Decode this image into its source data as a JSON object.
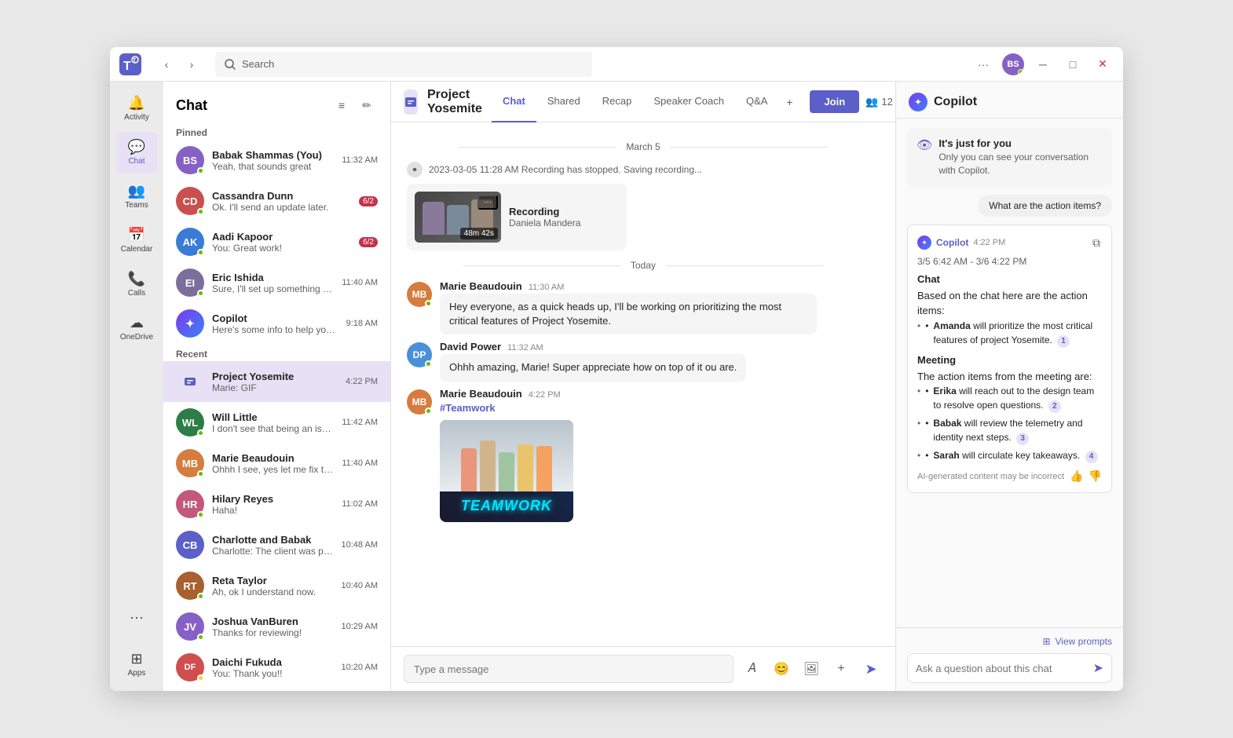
{
  "window": {
    "title": "Microsoft Teams"
  },
  "titlebar": {
    "search_placeholder": "Search",
    "more_label": "···",
    "minimize_label": "─",
    "maximize_label": "□",
    "close_label": "✕"
  },
  "sidebar": {
    "items": [
      {
        "id": "activity",
        "label": "Activity",
        "icon": "🔔",
        "badge": null,
        "active": false
      },
      {
        "id": "chat",
        "label": "Chat",
        "icon": "💬",
        "badge": null,
        "active": true
      },
      {
        "id": "teams",
        "label": "Teams",
        "icon": "👥",
        "badge": null,
        "active": false
      },
      {
        "id": "calendar",
        "label": "Calendar",
        "icon": "📅",
        "badge": null,
        "active": false
      },
      {
        "id": "calls",
        "label": "Calls",
        "icon": "📞",
        "badge": null,
        "active": false
      },
      {
        "id": "onedrive",
        "label": "OneDrive",
        "icon": "☁",
        "badge": null,
        "active": false
      }
    ],
    "more_label": "···",
    "apps_label": "Apps"
  },
  "chat_list": {
    "title": "Chat",
    "pinned_label": "Pinned",
    "recent_label": "Recent",
    "pinned": [
      {
        "name": "Babak Shammas (You)",
        "preview": "Yeah, that sounds great",
        "time": "11:32 AM",
        "badge": null,
        "avatar_color": "#8661c5",
        "avatar_initials": "BS",
        "status": "online"
      },
      {
        "name": "Cassandra Dunn",
        "preview": "Ok. I'll send an update later.",
        "time": "6/2",
        "badge": "6/2",
        "avatar_color": "#ca4f4f",
        "avatar_initials": "CD",
        "status": "online"
      },
      {
        "name": "Aadi Kapoor",
        "preview": "You: Great work!",
        "time": "6/2",
        "badge": "6/2",
        "avatar_color": "#3a7bd5",
        "avatar_initials": "AK",
        "status": "online"
      },
      {
        "name": "Eric Ishida",
        "preview": "Sure, I'll set up something for next week t...",
        "time": "11:40 AM",
        "badge": null,
        "avatar_color": "#7c6e9c",
        "avatar_initials": "EI",
        "status": "online"
      },
      {
        "name": "Copilot",
        "preview": "Here's some info to help you prep for your...",
        "time": "9:18 AM",
        "badge": null,
        "avatar_color": "#5b5fc7",
        "avatar_initials": "C",
        "status": null,
        "is_copilot": true
      }
    ],
    "recent": [
      {
        "name": "Project Yosemite",
        "preview": "Marie: GIF",
        "time": "4:22 PM",
        "badge": null,
        "avatar_color": "#e8e0f4",
        "avatar_initials": "PY",
        "status": null,
        "is_group": true,
        "active": true
      },
      {
        "name": "Will Little",
        "preview": "I don't see that being an issue. Can you ta...",
        "time": "11:42 AM",
        "badge": null,
        "avatar_color": "#2d7d46",
        "avatar_initials": "WL",
        "status": "online"
      },
      {
        "name": "Marie Beaudouin",
        "preview": "Ohhh I see, yes let me fix that!",
        "time": "11:40 AM",
        "badge": null,
        "avatar_color": "#d67c3e",
        "avatar_initials": "MB",
        "status": "online"
      },
      {
        "name": "Hilary Reyes",
        "preview": "Haha!",
        "time": "11:02 AM",
        "badge": null,
        "avatar_color": "#c4577c",
        "avatar_initials": "HR",
        "status": "online"
      },
      {
        "name": "Charlotte and Babak",
        "preview": "Charlotte: The client was pretty happy with...",
        "time": "10:48 AM",
        "badge": null,
        "avatar_color": "#5b5fc7",
        "avatar_initials": "CB",
        "status": null
      },
      {
        "name": "Reta Taylor",
        "preview": "Ah, ok I understand now.",
        "time": "10:40 AM",
        "badge": null,
        "avatar_color": "#a8612e",
        "avatar_initials": "RT",
        "status": "online"
      },
      {
        "name": "Joshua VanBuren",
        "preview": "Thanks for reviewing!",
        "time": "10:29 AM",
        "badge": null,
        "avatar_color": "#8661c5",
        "avatar_initials": "JV",
        "status": "online"
      },
      {
        "name": "Daichi Fukuda",
        "preview": "You: Thank you!!",
        "time": "10:20 AM",
        "badge": null,
        "avatar_color": "#d04e4e",
        "avatar_initials": "DF",
        "status": "away"
      }
    ]
  },
  "chat_header": {
    "title": "Project Yosemite",
    "tabs": [
      {
        "id": "chat",
        "label": "Chat",
        "active": true
      },
      {
        "id": "shared",
        "label": "Shared",
        "active": false
      },
      {
        "id": "recap",
        "label": "Recap",
        "active": false
      },
      {
        "id": "speaker_coach",
        "label": "Speaker Coach",
        "active": false
      },
      {
        "id": "qa",
        "label": "Q&A",
        "active": false
      }
    ],
    "join_label": "Join",
    "participants_count": "12",
    "add_tab_label": "+"
  },
  "messages": {
    "date_march5": "March 5",
    "date_today": "Today",
    "recording_stopped": "2023-03-05 11:28 AM  Recording has stopped. Saving recording...",
    "recording_title": "Recording",
    "recording_host": "Daniela Mandera",
    "recording_duration": "48m 42s",
    "msg1": {
      "sender": "Marie Beaudouin",
      "time": "11:30 AM",
      "text": "Hey everyone, as a quick heads up, I'll be working on prioritizing the most critical features of Project Yosemite.",
      "avatar_color": "#d67c3e",
      "initials": "MB",
      "status": "online"
    },
    "msg2": {
      "sender": "David Power",
      "time": "11:32 AM",
      "text": "Ohhh amazing, Marie! Super appreciate how on top of it ou are.",
      "avatar_color": "#4a90d9",
      "initials": "DP",
      "status": "online"
    },
    "msg3": {
      "sender": "Marie Beaudouin",
      "time": "4:22 PM",
      "text": "#Teamwork",
      "avatar_color": "#d67c3e",
      "initials": "MB",
      "status": "online",
      "has_gif": true
    }
  },
  "message_input": {
    "placeholder": "Type a message"
  },
  "copilot": {
    "title": "Copilot",
    "notice_title": "It's just for you",
    "notice_text": "Only you can see your conversation with Copilot.",
    "suggestion": "What are the action items?",
    "response_name": "Copilot",
    "response_time": "4:22 PM",
    "date_range": "3/5 6:42 AM - 3/6 4:22 PM",
    "chat_section": "Chat",
    "chat_intro": "Based on the chat here are the action items:",
    "chat_items": [
      {
        "person": "Amanda",
        "text": "will prioritize the most critical features of project Yosemite.",
        "badge": "1"
      }
    ],
    "meeting_section": "Meeting",
    "meeting_intro": "The action items from the meeting are:",
    "meeting_items": [
      {
        "person": "Erika",
        "text": "will reach out to the design team to resolve open questions.",
        "badge": "2"
      },
      {
        "person": "Babak",
        "text": "will review the telemetry and identity next steps.",
        "badge": "3"
      },
      {
        "person": "Sarah",
        "text": "will circulate key takeaways.",
        "badge": "4"
      }
    ],
    "ai_disclaimer": "AI-generated content may be incorrect",
    "view_prompts": "View prompts",
    "input_placeholder": "Ask a question about this chat",
    "copy_icon": "⧉"
  }
}
